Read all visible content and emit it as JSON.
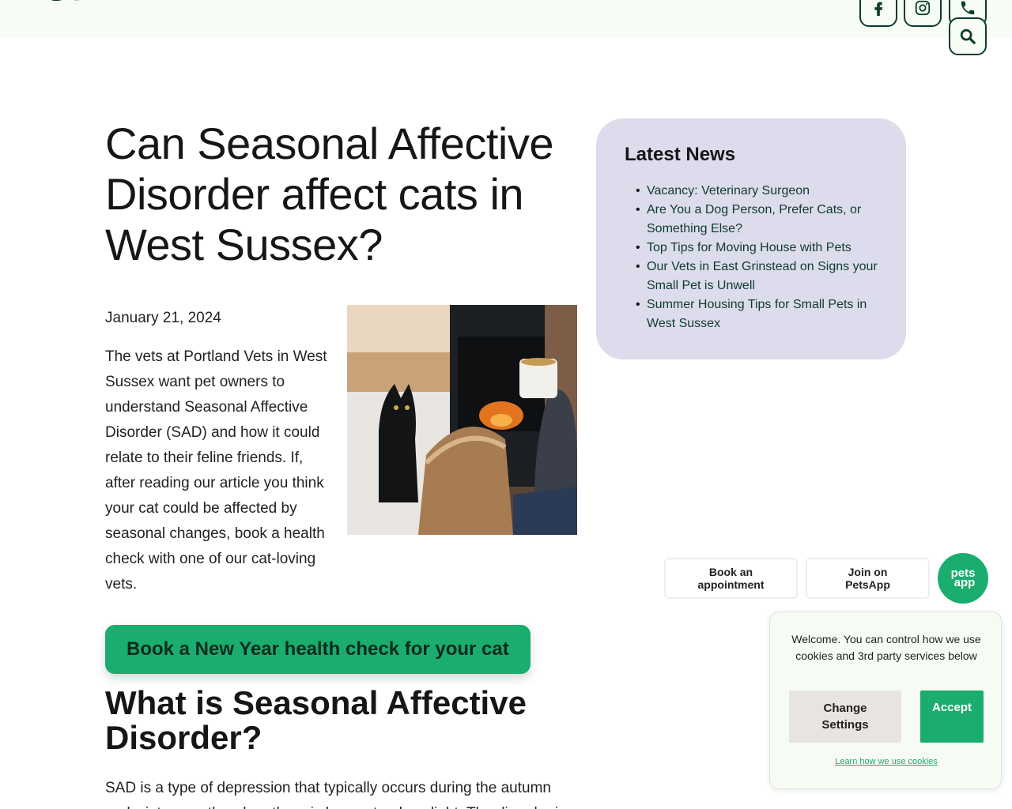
{
  "header": {
    "social": [
      {
        "icon": "facebook-icon"
      },
      {
        "icon": "instagram-icon"
      },
      {
        "icon": "phone-icon"
      },
      {
        "icon": "search-icon"
      }
    ],
    "brand_color": "#0d3b2e"
  },
  "article": {
    "title": "Can Seasonal Affective Disorder affect cats in West Sussex?",
    "date": "January 21, 2024",
    "intro": "The vets at Portland Vets in West Sussex want pet owners to understand Seasonal Affective Disorder (SAD) and how it could relate to their feline friends. If, after reading our article you think your cat could be affected by seasonal changes, book a health check with one of our cat-loving vets.",
    "cta_label": "Book a New Year health check for your cat",
    "section_heading": "What is Seasonal Affective Disorder?",
    "section_body": "SAD is a type of depression that typically occurs during the autumn and winter months when there is less natural sunlight. The disorder is"
  },
  "news": {
    "heading": "Latest News",
    "items": [
      "Vacancy: Veterinary Surgeon",
      "Are You a Dog Person, Prefer Cats, or Something Else?",
      "Top Tips for Moving House with Pets",
      "Our Vets in East Grinstead on Signs your Small Pet is Unwell",
      "Summer Housing Tips for Small Pets in West Sussex"
    ]
  },
  "floating": {
    "book_label": "Book an appointment",
    "join_label": "Join on PetsApp",
    "petsapp_line1": "pets",
    "petsapp_line2": "app"
  },
  "cookie": {
    "message": "Welcome. You can control how we use cookies and 3rd party services below",
    "change_label": "Change Settings",
    "accept_label": "Accept",
    "link_label": "Learn how we use cookies"
  },
  "colors": {
    "accent": "#1aad6e",
    "news_bg": "#dddcec",
    "topbar_bg": "#f7fdf5"
  }
}
